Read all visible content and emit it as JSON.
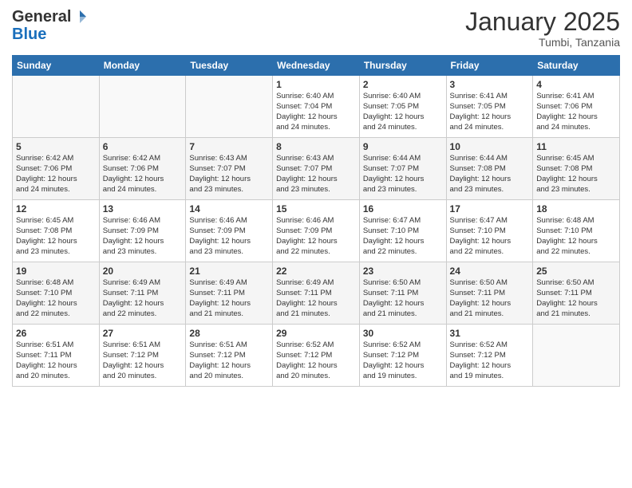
{
  "header": {
    "logo_general": "General",
    "logo_blue": "Blue",
    "month_title": "January 2025",
    "location": "Tumbi, Tanzania"
  },
  "columns": [
    "Sunday",
    "Monday",
    "Tuesday",
    "Wednesday",
    "Thursday",
    "Friday",
    "Saturday"
  ],
  "weeks": [
    [
      {
        "day": "",
        "info": ""
      },
      {
        "day": "",
        "info": ""
      },
      {
        "day": "",
        "info": ""
      },
      {
        "day": "1",
        "info": "Sunrise: 6:40 AM\nSunset: 7:04 PM\nDaylight: 12 hours\nand 24 minutes."
      },
      {
        "day": "2",
        "info": "Sunrise: 6:40 AM\nSunset: 7:05 PM\nDaylight: 12 hours\nand 24 minutes."
      },
      {
        "day": "3",
        "info": "Sunrise: 6:41 AM\nSunset: 7:05 PM\nDaylight: 12 hours\nand 24 minutes."
      },
      {
        "day": "4",
        "info": "Sunrise: 6:41 AM\nSunset: 7:06 PM\nDaylight: 12 hours\nand 24 minutes."
      }
    ],
    [
      {
        "day": "5",
        "info": "Sunrise: 6:42 AM\nSunset: 7:06 PM\nDaylight: 12 hours\nand 24 minutes."
      },
      {
        "day": "6",
        "info": "Sunrise: 6:42 AM\nSunset: 7:06 PM\nDaylight: 12 hours\nand 24 minutes."
      },
      {
        "day": "7",
        "info": "Sunrise: 6:43 AM\nSunset: 7:07 PM\nDaylight: 12 hours\nand 23 minutes."
      },
      {
        "day": "8",
        "info": "Sunrise: 6:43 AM\nSunset: 7:07 PM\nDaylight: 12 hours\nand 23 minutes."
      },
      {
        "day": "9",
        "info": "Sunrise: 6:44 AM\nSunset: 7:07 PM\nDaylight: 12 hours\nand 23 minutes."
      },
      {
        "day": "10",
        "info": "Sunrise: 6:44 AM\nSunset: 7:08 PM\nDaylight: 12 hours\nand 23 minutes."
      },
      {
        "day": "11",
        "info": "Sunrise: 6:45 AM\nSunset: 7:08 PM\nDaylight: 12 hours\nand 23 minutes."
      }
    ],
    [
      {
        "day": "12",
        "info": "Sunrise: 6:45 AM\nSunset: 7:08 PM\nDaylight: 12 hours\nand 23 minutes."
      },
      {
        "day": "13",
        "info": "Sunrise: 6:46 AM\nSunset: 7:09 PM\nDaylight: 12 hours\nand 23 minutes."
      },
      {
        "day": "14",
        "info": "Sunrise: 6:46 AM\nSunset: 7:09 PM\nDaylight: 12 hours\nand 23 minutes."
      },
      {
        "day": "15",
        "info": "Sunrise: 6:46 AM\nSunset: 7:09 PM\nDaylight: 12 hours\nand 22 minutes."
      },
      {
        "day": "16",
        "info": "Sunrise: 6:47 AM\nSunset: 7:10 PM\nDaylight: 12 hours\nand 22 minutes."
      },
      {
        "day": "17",
        "info": "Sunrise: 6:47 AM\nSunset: 7:10 PM\nDaylight: 12 hours\nand 22 minutes."
      },
      {
        "day": "18",
        "info": "Sunrise: 6:48 AM\nSunset: 7:10 PM\nDaylight: 12 hours\nand 22 minutes."
      }
    ],
    [
      {
        "day": "19",
        "info": "Sunrise: 6:48 AM\nSunset: 7:10 PM\nDaylight: 12 hours\nand 22 minutes."
      },
      {
        "day": "20",
        "info": "Sunrise: 6:49 AM\nSunset: 7:11 PM\nDaylight: 12 hours\nand 22 minutes."
      },
      {
        "day": "21",
        "info": "Sunrise: 6:49 AM\nSunset: 7:11 PM\nDaylight: 12 hours\nand 21 minutes."
      },
      {
        "day": "22",
        "info": "Sunrise: 6:49 AM\nSunset: 7:11 PM\nDaylight: 12 hours\nand 21 minutes."
      },
      {
        "day": "23",
        "info": "Sunrise: 6:50 AM\nSunset: 7:11 PM\nDaylight: 12 hours\nand 21 minutes."
      },
      {
        "day": "24",
        "info": "Sunrise: 6:50 AM\nSunset: 7:11 PM\nDaylight: 12 hours\nand 21 minutes."
      },
      {
        "day": "25",
        "info": "Sunrise: 6:50 AM\nSunset: 7:11 PM\nDaylight: 12 hours\nand 21 minutes."
      }
    ],
    [
      {
        "day": "26",
        "info": "Sunrise: 6:51 AM\nSunset: 7:11 PM\nDaylight: 12 hours\nand 20 minutes."
      },
      {
        "day": "27",
        "info": "Sunrise: 6:51 AM\nSunset: 7:12 PM\nDaylight: 12 hours\nand 20 minutes."
      },
      {
        "day": "28",
        "info": "Sunrise: 6:51 AM\nSunset: 7:12 PM\nDaylight: 12 hours\nand 20 minutes."
      },
      {
        "day": "29",
        "info": "Sunrise: 6:52 AM\nSunset: 7:12 PM\nDaylight: 12 hours\nand 20 minutes."
      },
      {
        "day": "30",
        "info": "Sunrise: 6:52 AM\nSunset: 7:12 PM\nDaylight: 12 hours\nand 19 minutes."
      },
      {
        "day": "31",
        "info": "Sunrise: 6:52 AM\nSunset: 7:12 PM\nDaylight: 12 hours\nand 19 minutes."
      },
      {
        "day": "",
        "info": ""
      }
    ]
  ]
}
